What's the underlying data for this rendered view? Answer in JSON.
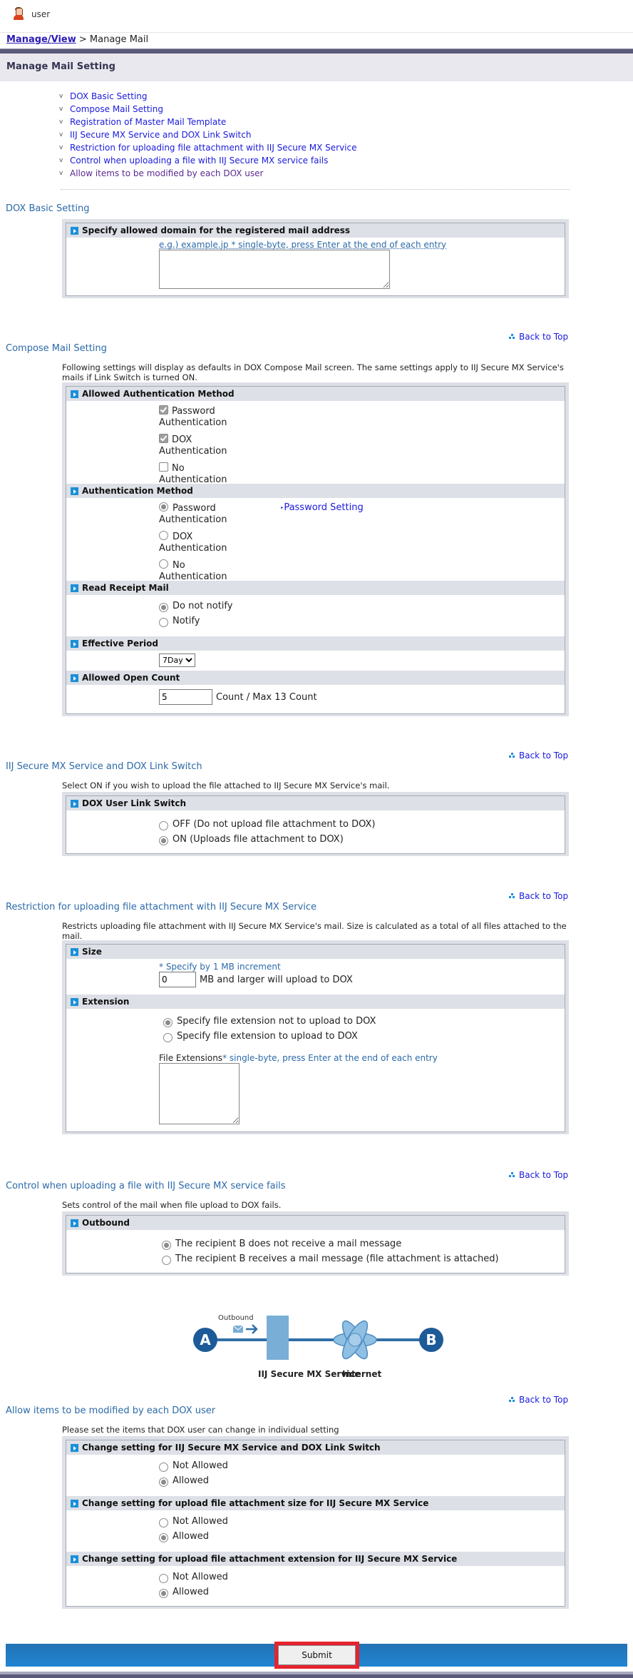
{
  "user": {
    "name": "user",
    "icon": "user-avatar-icon"
  },
  "breadcrumb": {
    "parent": "Manage/View",
    "separator": ">",
    "current": "Manage Mail"
  },
  "page_title": "Manage Mail Setting",
  "toc": [
    "DOX Basic Setting",
    "Compose Mail Setting",
    "Registration of Master Mail Template",
    "IIJ Secure MX Service and DOX Link Switch",
    "Restriction for uploading file attachment with IIJ Secure MX Service",
    "Control when uploading a file with IIJ Secure MX service fails",
    "Allow items to be modified by each DOX user"
  ],
  "back_to_top": "Back to Top",
  "basic": {
    "title": "DOX Basic Setting",
    "domain_header": "Specify allowed domain for the registered mail address",
    "domain_hint": "e.g.) example.jp * single-byte, press Enter at the end of each entry",
    "domain_value": ""
  },
  "compose": {
    "title": "Compose Mail Setting",
    "desc": "Following settings will display as defaults in DOX Compose Mail screen. The same settings apply to IIJ Secure MX Service's mails if Link Switch is turned ON.",
    "allowed_auth": {
      "header": "Allowed Authentication Method",
      "options": [
        {
          "label": "Password Authentication",
          "checked": true
        },
        {
          "label": "DOX Authentication",
          "checked": true
        },
        {
          "label": "No Authentication",
          "checked": false
        }
      ]
    },
    "auth_method": {
      "header": "Authentication Method",
      "options": [
        "Password Authentication",
        "DOX Authentication",
        "No Authentication"
      ],
      "selected": "Password Authentication",
      "password_link": "Password Setting"
    },
    "read_receipt": {
      "header": "Read Receipt Mail",
      "options": [
        "Do not notify",
        "Notify"
      ],
      "selected": "Do not notify"
    },
    "effective_period": {
      "header": "Effective Period",
      "value": "7Day"
    },
    "open_count": {
      "header": "Allowed Open Count",
      "value": "5",
      "suffix": "Count / Max 13 Count"
    }
  },
  "link_switch": {
    "title": "IIJ Secure MX Service and DOX Link Switch",
    "desc": "Select ON if you wish to upload the file attached to IIJ Secure MX Service's mail.",
    "header": "DOX User Link Switch",
    "options": [
      "OFF (Do not upload file attachment to DOX)",
      "ON (Uploads file attachment to DOX)"
    ],
    "selected": "ON (Uploads file attachment to DOX)"
  },
  "restriction": {
    "title": "Restriction for uploading file attachment with IIJ Secure MX Service",
    "desc": "Restricts uploading file attachment with IIJ Secure MX Service's mail. Size is calculated as a total of all files attached to the mail.",
    "size_header": "Size",
    "size_hint": "* Specify by 1 MB increment",
    "size_value": "0",
    "size_suffix": "MB and larger will upload to DOX",
    "ext_header": "Extension",
    "ext_options": [
      "Specify file extension not to upload to DOX",
      "Specify file extension to upload to DOX"
    ],
    "ext_selected": "Specify file extension not to upload to DOX",
    "ext_label": "File Extensions",
    "ext_hint": "* single-byte, press Enter at the end of each entry",
    "ext_value": ""
  },
  "fail_control": {
    "title": "Control when uploading a file with IIJ Secure MX service fails",
    "desc": "Sets control of the mail when file upload to DOX fails.",
    "header": "Outbound",
    "options": [
      "The recipient B does not receive a mail message",
      "The recipient B receives a mail message (file attachment is attached)"
    ],
    "selected": "The recipient B does not receive a mail message"
  },
  "diagram": {
    "label_outbound": "Outbound",
    "node_a": "A",
    "node_b": "B",
    "label_service": "IIJ Secure MX Service",
    "label_internet": "Internet"
  },
  "modify": {
    "title": "Allow items to be modified by each DOX user",
    "desc": "Please set the items that DOX user can change in individual setting",
    "groups": [
      {
        "header": "Change setting for IIJ Secure MX Service and DOX Link Switch",
        "options": [
          "Not Allowed",
          "Allowed"
        ],
        "selected": "Allowed"
      },
      {
        "header": "Change setting for upload file attachment size for IIJ Secure MX Service",
        "options": [
          "Not Allowed",
          "Allowed"
        ],
        "selected": "Allowed"
      },
      {
        "header": "Change setting for upload file attachment extension for IIJ Secure MX Service",
        "options": [
          "Not Allowed",
          "Allowed"
        ],
        "selected": "Allowed"
      }
    ]
  },
  "footer": {
    "submit_label": "Submit"
  },
  "colors": {
    "accent_blue": "#2185d2",
    "heading_blue": "#2c6aa8",
    "link": "#1a1adc",
    "highlight_red": "#e5232e",
    "header_bar": "#5a5a78"
  }
}
